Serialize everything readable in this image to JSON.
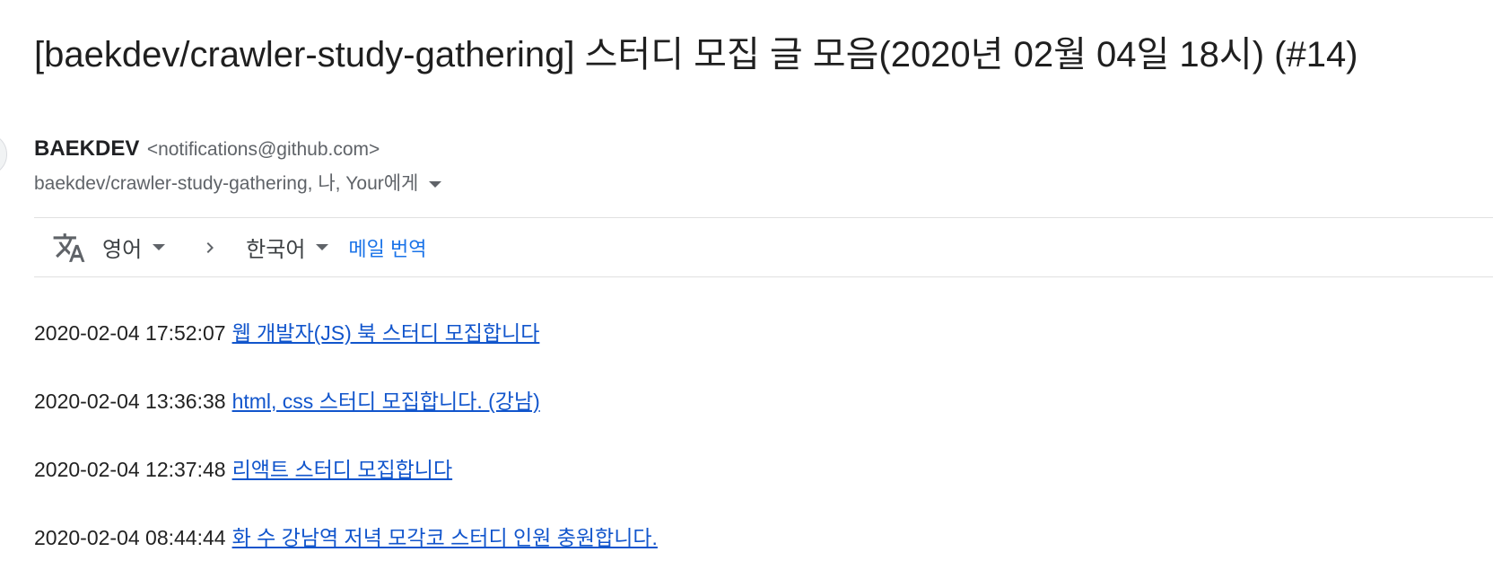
{
  "email": {
    "subject": "[baekdev/crawler-study-gathering] 스터디 모집 글 모음(2020년 02월 04일 18시) (#14)",
    "sender": {
      "name": "BAEKDEV",
      "email": "<notifications@github.com>"
    },
    "recipients": "baekdev/crawler-study-gathering, 나, Your에게"
  },
  "translate_bar": {
    "source_language": "영어",
    "target_language": "한국어",
    "translate_link": "메일 번역"
  },
  "posts": [
    {
      "timestamp": "2020-02-04 17:52:07",
      "title": "웹 개발자(JS) 북 스터디 모집합니다"
    },
    {
      "timestamp": "2020-02-04 13:36:38",
      "title": "html, css 스터디 모집합니다. (강남)"
    },
    {
      "timestamp": "2020-02-04 12:37:48",
      "title": "리액트 스터디 모집합니다"
    },
    {
      "timestamp": "2020-02-04 08:44:44",
      "title": "화 수 강남역 저녁 모각코 스터디 인원 충원합니다."
    }
  ],
  "icons": {
    "translate": "translate-icon",
    "chevron_right": "chevron-right-icon",
    "dropdown": "caret-down-icon"
  },
  "colors": {
    "link": "#1155cc",
    "accent": "#1a73e8",
    "secondary_text": "#5f6368"
  }
}
